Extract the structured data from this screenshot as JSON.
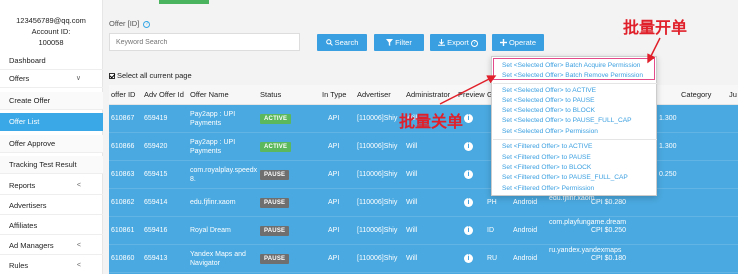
{
  "sidebar": {
    "account_email": "123456789@qq.com",
    "account_id_label": "Account ID:",
    "account_id": "100058",
    "items": [
      {
        "label": "Dashboard",
        "chevron": ""
      },
      {
        "label": "Offers",
        "chevron": "∨"
      },
      {
        "label": "Create Offer",
        "chevron": ""
      },
      {
        "label": "Offer List",
        "chevron": ""
      },
      {
        "label": "Offer Approve",
        "chevron": ""
      },
      {
        "label": "Tracking Test Result",
        "chevron": ""
      },
      {
        "label": "Reports",
        "chevron": "<"
      },
      {
        "label": "Advertisers",
        "chevron": ""
      },
      {
        "label": "Affiliates",
        "chevron": ""
      },
      {
        "label": "Ad Managers",
        "chevron": "<"
      },
      {
        "label": "Rules",
        "chevron": "<"
      }
    ]
  },
  "toolbar": {
    "offer_label": "Offer [ID]",
    "help_glyph": "?",
    "search_placeholder": "Keyword Search",
    "search_label": "Search",
    "filter_label": "Filter",
    "export_label": "Export",
    "operate_label": "Operate"
  },
  "select_all_label": "Select all current page",
  "table": {
    "headers": [
      "offer ID",
      "Adv Offer Id",
      "Offer Name",
      "Status",
      "In Type",
      "Advertiser",
      "Administrator",
      "Preview",
      "G",
      "",
      "",
      "",
      "Category",
      "Ju"
    ],
    "rows": [
      {
        "offer_id": "610867",
        "adv_id": "659419",
        "name": "Pay2app : UPI Payments",
        "status": "ACTIVE",
        "in_type": "API",
        "advertiser": "[110006]Shiy",
        "admin": "Will",
        "geo": "",
        "platform": "",
        "pkg": "",
        "cpi": "",
        "extra": "1.300"
      },
      {
        "offer_id": "610866",
        "adv_id": "659420",
        "name": "Pay2app : UPI Payments",
        "status": "ACTIVE",
        "in_type": "API",
        "advertiser": "[110006]Shiy",
        "admin": "Will",
        "geo": "",
        "platform": "",
        "pkg": "",
        "cpi": "",
        "extra": "1.300"
      },
      {
        "offer_id": "610863",
        "adv_id": "659415",
        "name": "com.royalplay.speedx 8.",
        "status": "PAUSE",
        "in_type": "API",
        "advertiser": "[110006]Shiy",
        "admin": "Will",
        "geo": "",
        "platform": "",
        "pkg": "",
        "cpi": "",
        "extra": "0.250"
      },
      {
        "offer_id": "610862",
        "adv_id": "659414",
        "name": "edu.fjfinr.xaom",
        "status": "PAUSE",
        "in_type": "API",
        "advertiser": "[110006]Shiy",
        "admin": "Will",
        "geo": "PH",
        "platform": "Android",
        "pkg": "edu.fjfinr.xaom",
        "cpi": "CPI $0.280",
        "extra": "CPI $0.280"
      },
      {
        "offer_id": "610861",
        "adv_id": "659416",
        "name": "Royal Dream",
        "status": "PAUSE",
        "in_type": "API",
        "advertiser": "[110006]Shiy",
        "admin": "Will",
        "geo": "ID",
        "platform": "Android",
        "pkg": "com.playfungame.dream",
        "cpi": "CPI $0.250",
        "extra": "CPI $0.250"
      },
      {
        "offer_id": "610860",
        "adv_id": "659413",
        "name": "Yandex Maps and Navigator",
        "status": "PAUSE",
        "in_type": "API",
        "advertiser": "[110006]Shiy",
        "admin": "Will",
        "geo": "RU",
        "platform": "Android",
        "pkg": "ru.yandex.yandexmaps",
        "cpi": "CPI $0.180",
        "extra": "CPI $0.180"
      }
    ]
  },
  "operate_menu": {
    "selected": [
      "Set <Selected Offer> Batch Acquire Permission",
      "Set <Selected Offer> Batch Remove Permission",
      "Set <Selected Offer> to ACTIVE",
      "Set <Selected Offer> to PAUSE",
      "Set <Selected Offer> to BLOCK",
      "Set <Selected Offer> to PAUSE_FULL_CAP",
      "Set <Selected Offer> Permission"
    ],
    "filtered": [
      "Set <Filtered Offer> to ACTIVE",
      "Set <Filtered Offer> to PAUSE",
      "Set <Filtered Offer> to BLOCK",
      "Set <Filtered Offer> to PAUSE_FULL_CAP",
      "Set <Filtered Offer> Permission"
    ]
  },
  "annotations": {
    "batch_on": "批量开单",
    "batch_off": "批量关单"
  },
  "colors": {
    "accent": "#3a9fe0",
    "row_highlight": "#4aa9e0",
    "active_badge": "#5cb85c",
    "pause_badge": "#6f6f6f",
    "annotation_red": "#e0202a"
  },
  "icons": [
    "search-icon",
    "filter-icon",
    "export-icon",
    "operate-icon",
    "info-icon",
    "help-icon"
  ]
}
